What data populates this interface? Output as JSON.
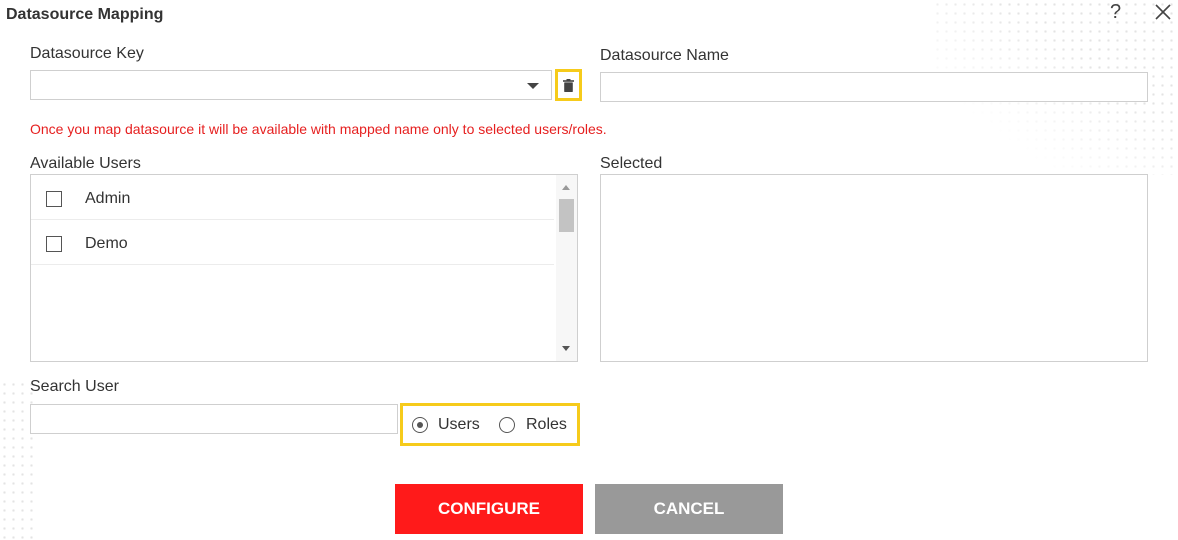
{
  "dialog": {
    "title": "Datasource Mapping",
    "help_symbol": "?"
  },
  "form": {
    "datasource_key": {
      "label": "Datasource Key",
      "value": ""
    },
    "datasource_name": {
      "label": "Datasource Name",
      "value": ""
    },
    "warning": "Once you map datasource it will be available with mapped name only to selected users/roles.",
    "available": {
      "label": "Available Users",
      "items": [
        {
          "name": "Admin",
          "checked": false
        },
        {
          "name": "Demo",
          "checked": false
        }
      ]
    },
    "selected": {
      "label": "Selected"
    },
    "search": {
      "label": "Search User",
      "value": ""
    },
    "filter": {
      "options": [
        {
          "label": "Users",
          "selected": true
        },
        {
          "label": "Roles",
          "selected": false
        }
      ]
    }
  },
  "actions": {
    "configure_label": "CONFIGURE",
    "cancel_label": "CANCEL"
  },
  "colors": {
    "accent_red": "#ff1a1a",
    "cancel_gray": "#999999",
    "highlight_yellow": "#f6cb1b",
    "warning_red": "#e61f1f"
  }
}
